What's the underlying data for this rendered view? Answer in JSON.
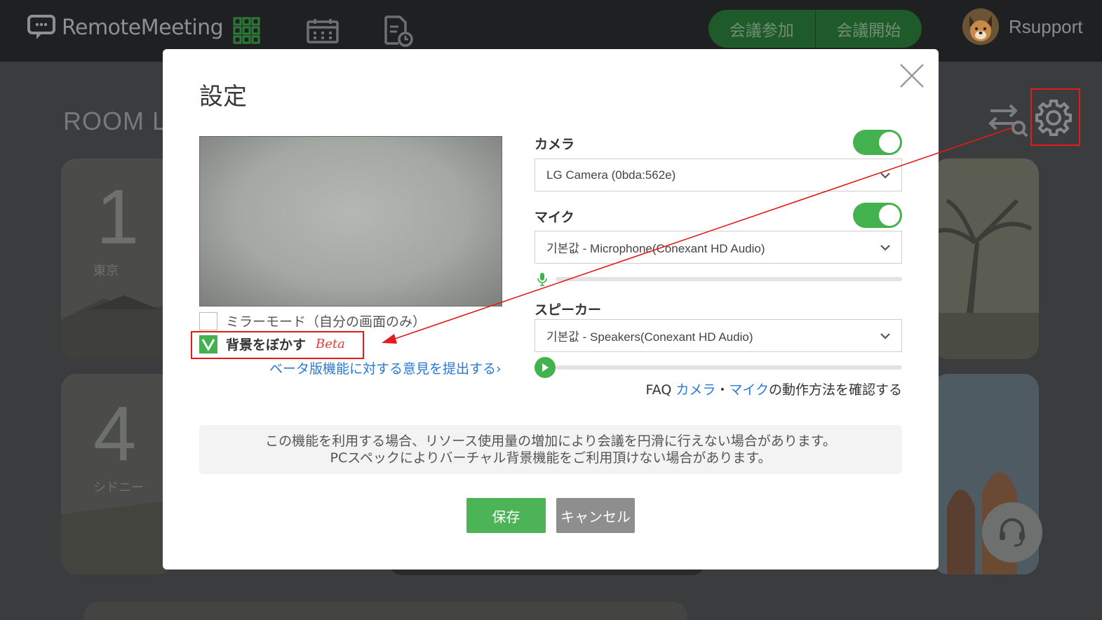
{
  "app": {
    "logo_text": "RemoteMeeting",
    "join_label": "会議参加",
    "start_label": "会議開始",
    "user_name": "Rsupport"
  },
  "background": {
    "room_title": "ROOM LI",
    "rooms": [
      {
        "num": "1",
        "city": "東京"
      },
      {
        "num": "4",
        "city": "シドニー"
      }
    ]
  },
  "modal": {
    "title": "設定",
    "mirror_label": "ミラーモード（自分の画面のみ）",
    "mirror_checked": false,
    "blur_label": "背景をぼかす",
    "blur_checked": true,
    "beta_label": "Beta",
    "feedback_link": "ベータ版機能に対する意見を提出する",
    "camera": {
      "label": "カメラ",
      "enabled": true,
      "selected": "LG Camera (0bda:562e)"
    },
    "mic": {
      "label": "マイク",
      "enabled": true,
      "selected": "기본값 - Microphone(Conexant HD Audio)"
    },
    "speaker": {
      "label": "スピーカー",
      "selected": "기본값 - Speakers(Conexant HD Audio)"
    },
    "faq": {
      "prefix": "FAQ ",
      "link_camera": "カメラ",
      "separator": "・",
      "link_mic": "マイク",
      "suffix": "の動作方法を確認する"
    },
    "notice_line1": "この機能を利用する場合、リソース使用量の増加により会議を円滑に行えない場合があります。",
    "notice_line2": "PCスペックによりバーチャル背景機能をご利用頂けない場合があります。",
    "save_label": "保存",
    "cancel_label": "キャンセル"
  },
  "colors": {
    "accent_green": "#43b14e",
    "link_blue": "#2979d4",
    "annotation_red": "#e31b1b"
  }
}
